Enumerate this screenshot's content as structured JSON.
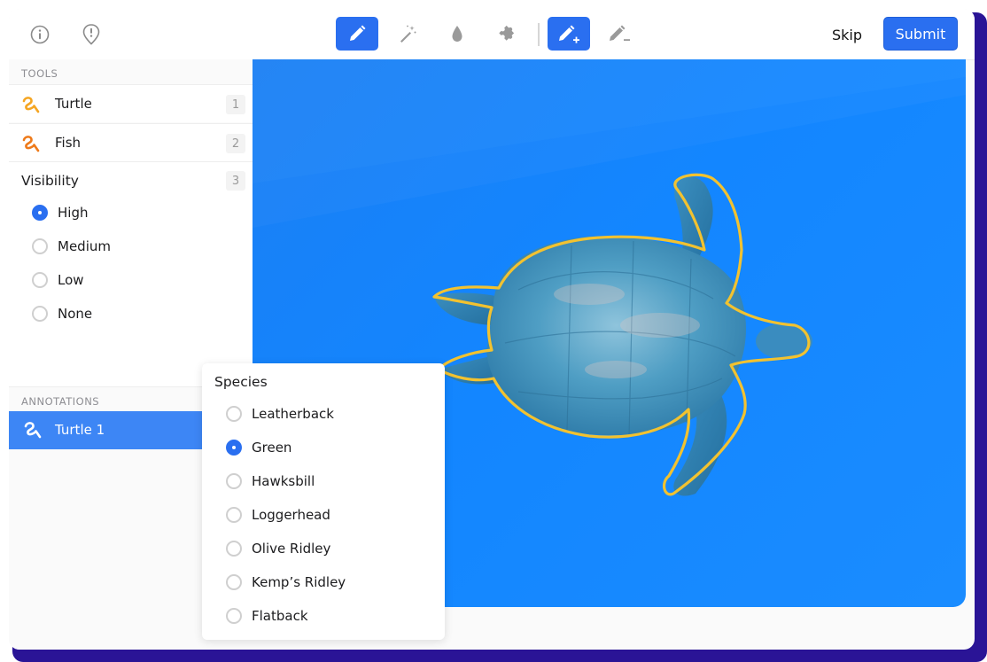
{
  "toolbar": {
    "skip_label": "Skip",
    "submit_label": "Submit",
    "accent_color": "#2a6ff0"
  },
  "sidebar": {
    "tools_header": "TOOLS",
    "tools": [
      {
        "label": "Turtle",
        "hotkey": "1",
        "icon": "polyline-icon",
        "color": "#f5a623"
      },
      {
        "label": "Fish",
        "hotkey": "2",
        "icon": "polyline-icon",
        "color": "#ee7a1a"
      }
    ],
    "visibility": {
      "title": "Visibility",
      "hotkey": "3",
      "options": [
        "High",
        "Medium",
        "Low",
        "None"
      ],
      "selected": "High"
    },
    "annotations_header": "ANNOTATIONS",
    "annotations": [
      {
        "label": "Turtle 1",
        "icon": "polyline-icon",
        "selected": true
      }
    ]
  },
  "species": {
    "title": "Species",
    "options": [
      "Leatherback",
      "Green",
      "Hawksbill",
      "Loggerhead",
      "Olive Ridley",
      "Kemp’s Ridley",
      "Flatback"
    ],
    "selected": "Green"
  },
  "canvas": {
    "background_color": "#1386ff",
    "outline_color": "#f2c230"
  }
}
